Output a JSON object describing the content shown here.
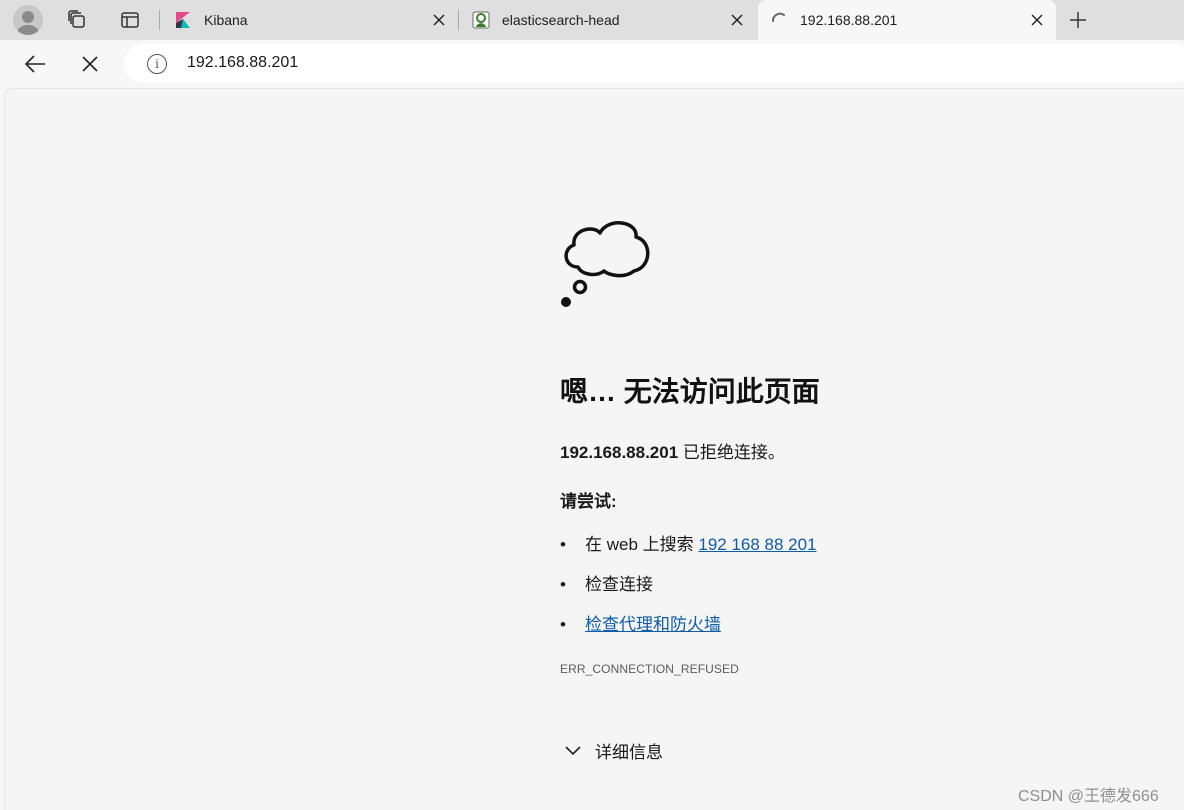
{
  "tabs": [
    {
      "title": "Kibana",
      "icon": "kibana-logo-icon",
      "active": false
    },
    {
      "title": "elasticsearch-head",
      "icon": "elasticsearch-head-logo-icon",
      "active": false
    },
    {
      "title": "192.168.88.201",
      "icon": "loading-spinner-icon",
      "active": true
    }
  ],
  "address_bar": {
    "url": "192.168.88.201",
    "icon": "info-icon"
  },
  "error_page": {
    "title": "嗯… 无法访问此页面",
    "host": "192.168.88.201",
    "message": " 已拒绝连接。",
    "try_label": "请尝试:",
    "suggestions": [
      {
        "prefix": "在 web 上搜索 ",
        "link": "192 168 88 201"
      },
      {
        "text": "检查连接"
      },
      {
        "link": "检查代理和防火墙"
      }
    ],
    "error_code": "ERR_CONNECTION_REFUSED",
    "details_label": "详细信息"
  },
  "watermark": "CSDN @王德发666",
  "colors": {
    "link": "#0f5ba8",
    "tabstrip": "#dfdfdf",
    "page_bg": "#f5f5f5"
  }
}
